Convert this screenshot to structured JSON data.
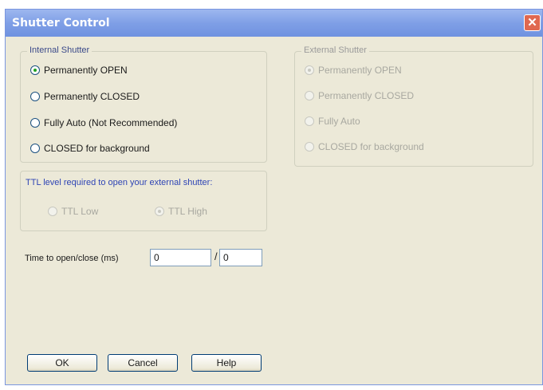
{
  "window": {
    "title": "Shutter Control",
    "close_glyph": "✕"
  },
  "internal": {
    "legend": "Internal Shutter",
    "options": [
      {
        "label": "Permanently OPEN",
        "checked": true
      },
      {
        "label": "Permanently CLOSED",
        "checked": false
      },
      {
        "label": "Fully Auto (Not Recommended)",
        "checked": false
      },
      {
        "label": "CLOSED for background",
        "checked": false
      }
    ]
  },
  "external": {
    "legend": "External Shutter",
    "options": [
      {
        "label": "Permanently OPEN",
        "checked": true
      },
      {
        "label": "Permanently CLOSED",
        "checked": false
      },
      {
        "label": "Fully Auto",
        "checked": false
      },
      {
        "label": "CLOSED for background",
        "checked": false
      }
    ]
  },
  "ttl": {
    "legend": "TTL level required to open your external shutter:",
    "low_label": "TTL Low",
    "high_label": "TTL High"
  },
  "timing": {
    "label": "Time to open/close (ms)",
    "open_value": "0",
    "separator": "/",
    "close_value": "0"
  },
  "buttons": {
    "ok": "OK",
    "cancel": "Cancel",
    "help": "Help"
  }
}
